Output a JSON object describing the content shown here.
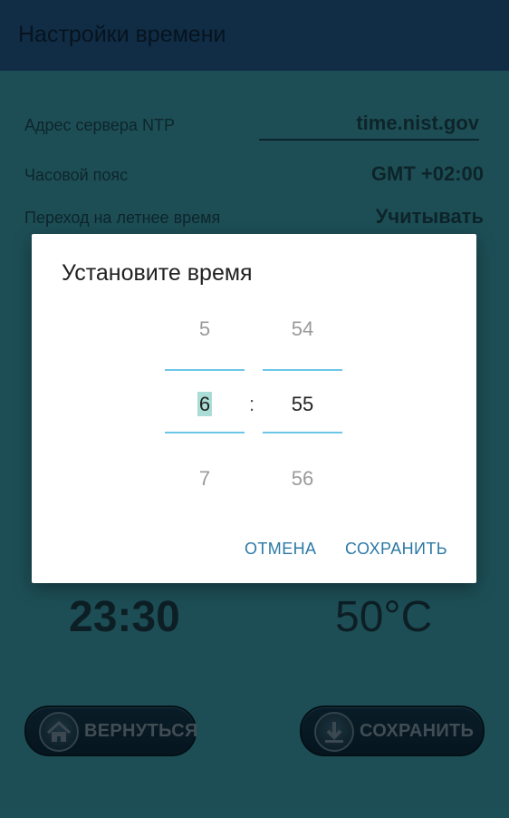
{
  "appbar": {
    "title": "Настройки времени"
  },
  "settings": {
    "ntp_label": "Адрес сервера NTP",
    "ntp_value": "time.nist.gov",
    "timezone_label": "Часовой пояс",
    "timezone_value": "GMT +02:00",
    "dst_label": "Переход на летнее время",
    "dst_value": "Учитывать"
  },
  "readouts": {
    "time": "23:30",
    "temperature": "50°C"
  },
  "buttons": {
    "back_label": "ВЕРНУТЬСЯ",
    "save_label": "СОХРАНИТЬ"
  },
  "dialog": {
    "title": "Установите время",
    "hour_prev": "5",
    "hour_current": "6",
    "hour_next": "7",
    "separator": ":",
    "minute_prev": "54",
    "minute_current": "55",
    "minute_next": "56",
    "cancel_label": "ОТМЕНА",
    "ok_label": "СОХРАНИТЬ"
  },
  "colors": {
    "appbar": "#1a4a70",
    "background": "#2f7f8c",
    "accent_line": "#6cc6e6",
    "dialog_button": "#2a79a6"
  },
  "icons": {
    "back": "home-icon",
    "save": "download-icon"
  }
}
